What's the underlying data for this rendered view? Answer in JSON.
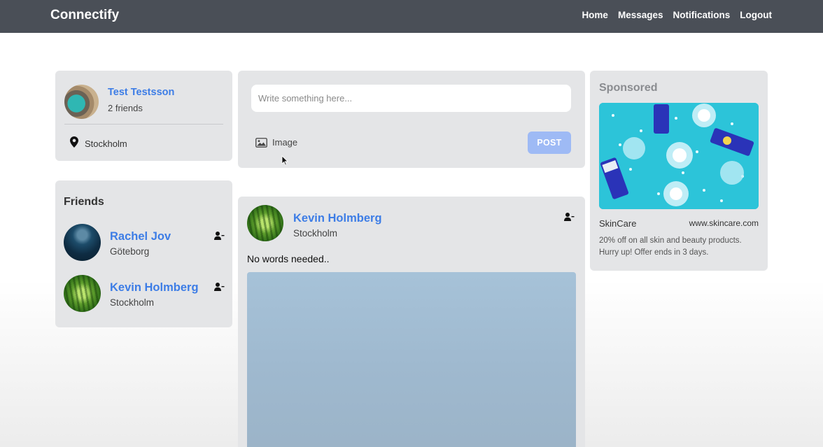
{
  "brand": "Connectify",
  "nav": [
    "Home",
    "Messages",
    "Notifications",
    "Logout"
  ],
  "profile": {
    "name": "Test Testsson",
    "friends_count": "2 friends",
    "location": "Stockholm"
  },
  "composer": {
    "placeholder": "Write something here...",
    "image_label": "Image",
    "post_label": "POST"
  },
  "friends": {
    "title": "Friends",
    "items": [
      {
        "name": "Rachel Jov",
        "location": "Göteborg"
      },
      {
        "name": "Kevin Holmberg",
        "location": "Stockholm"
      }
    ]
  },
  "post": {
    "author": "Kevin Holmberg",
    "location": "Stockholm",
    "text": "No words needed.."
  },
  "sponsored": {
    "title": "Sponsored",
    "brand": "SkinCare",
    "url": "www.skincare.com",
    "description": "20% off on all skin and beauty products. Hurry up! Offer ends in 3 days."
  },
  "colors": {
    "navbar": "#4a4f57",
    "link": "#3d7de6",
    "card": "#e4e5e7",
    "post_button": "#9ebaf5"
  }
}
